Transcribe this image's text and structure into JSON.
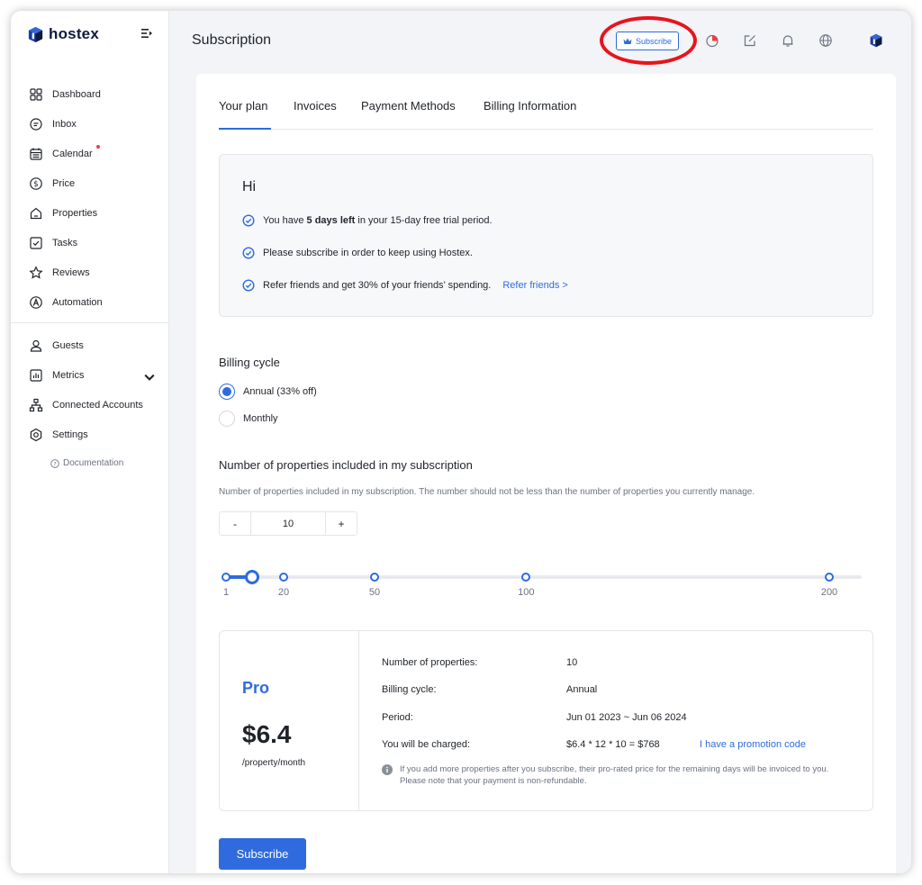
{
  "brand": {
    "name": "hostex",
    "logo_icon": "hostex-cube-logo"
  },
  "sidebar": {
    "items": [
      {
        "label": "Dashboard",
        "icon": "grid-icon"
      },
      {
        "label": "Inbox",
        "icon": "chat-icon"
      },
      {
        "label": "Calendar",
        "icon": "calendar-icon",
        "badge_dot": true
      },
      {
        "label": "Price",
        "icon": "dollar-icon"
      },
      {
        "label": "Properties",
        "icon": "house-icon"
      },
      {
        "label": "Tasks",
        "icon": "checkbox-icon"
      },
      {
        "label": "Reviews",
        "icon": "star-icon"
      },
      {
        "label": "Automation",
        "icon": "automation-icon"
      },
      {
        "label": "Guests",
        "icon": "user-icon"
      },
      {
        "label": "Metrics",
        "icon": "chart-icon",
        "expandable": true
      },
      {
        "label": "Connected Accounts",
        "icon": "network-icon"
      },
      {
        "label": "Settings",
        "icon": "gear-icon"
      }
    ],
    "documentation": "Documentation"
  },
  "header": {
    "title": "Subscription",
    "subscribe_button": "Subscribe",
    "accent": "#2f6bde",
    "highlight_color": "#e8141c"
  },
  "tabs": [
    {
      "label": "Your plan",
      "active": true
    },
    {
      "label": "Invoices",
      "active": false
    },
    {
      "label": "Payment Methods",
      "active": false
    },
    {
      "label": "Billing Information",
      "active": false
    }
  ],
  "notice": {
    "greeting": "Hi",
    "line1_prefix": "You have ",
    "line1_bold": "5 days left",
    "line1_suffix": " in your 15-day free trial period.",
    "line2": "Please subscribe in order to keep using Hostex.",
    "line3": "Refer friends and get 30% of your friends’ spending.",
    "line3_link": "Refer friends >"
  },
  "billing": {
    "title": "Billing cycle",
    "options": [
      {
        "label": "Annual (33% off)",
        "selected": true
      },
      {
        "label": "Monthly",
        "selected": false
      }
    ]
  },
  "properties": {
    "title": "Number of properties included in my subscription",
    "help": "Number of properties included in my subscription. The number should not be less than the number of properties you currently manage.",
    "minus": "-",
    "plus": "+",
    "value": "10",
    "slider": {
      "min": 1,
      "max": 200,
      "value": 10,
      "stops": [
        1,
        20,
        50,
        100,
        200
      ]
    }
  },
  "plan": {
    "name": "Pro",
    "price": "$6.4",
    "unit": "/property/month",
    "rows": [
      {
        "label": "Number of properties:",
        "value": "10"
      },
      {
        "label": "Billing cycle:",
        "value": "Annual"
      },
      {
        "label": "Period:",
        "value": "Jun 01 2023 ~ Jun 06 2024"
      },
      {
        "label": "You will be charged:",
        "value": "$6.4 * 12 * 10 = $768"
      }
    ],
    "promo_link": "I have a promotion code",
    "note": "If you add more properties after you subscribe, their pro-rated price for the remaining days will be invoiced to you. Please note that your payment is non-refundable."
  },
  "primary_button": "Subscribe"
}
